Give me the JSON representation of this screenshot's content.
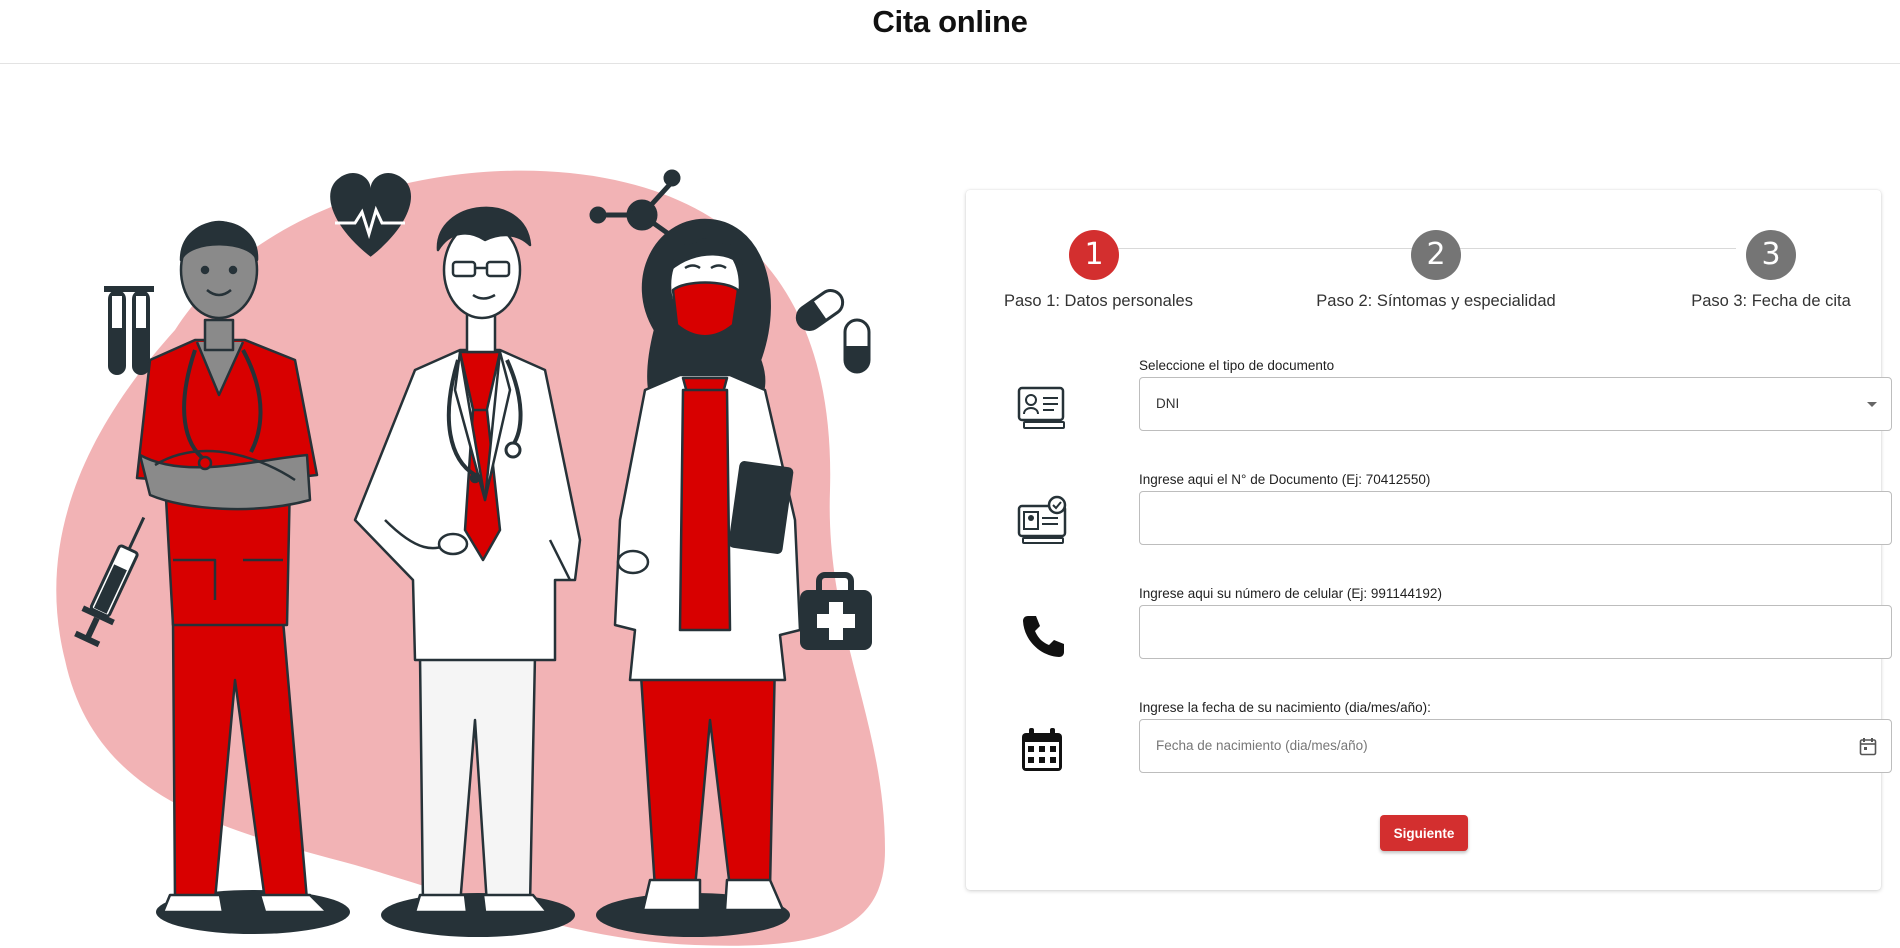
{
  "header": {
    "title": "Cita online"
  },
  "stepper": {
    "steps": [
      {
        "number": "1",
        "label": "Paso 1: Datos personales",
        "state": "active"
      },
      {
        "number": "2",
        "label": "Paso 2: Síntomas y especialidad",
        "state": "inactive"
      },
      {
        "number": "3",
        "label": "Paso 3: Fecha de cita",
        "state": "inactive"
      }
    ]
  },
  "form": {
    "document_type": {
      "label": "Seleccione el tipo de documento",
      "value": "DNI",
      "icon": "id-card-icon"
    },
    "document_number": {
      "label": "Ingrese aqui el N° de Documento (Ej: 70412550)",
      "value": "",
      "icon": "verified-id-icon"
    },
    "phone": {
      "label": "Ingrese aqui su número de celular (Ej: 991144192)",
      "value": "",
      "icon": "phone-icon"
    },
    "birth_date": {
      "label": "Ingrese la fecha de su nacimiento (dia/mes/año):",
      "placeholder": "Fecha de nacimiento (dia/mes/año)",
      "icon": "calendar-icon"
    },
    "next_label": "Siguiente"
  },
  "colors": {
    "accent": "#d32f2f",
    "inactive_step": "#757575",
    "illustration_blob": "#f2b3b5",
    "scrub_red": "#d80000",
    "ink": "#263238"
  }
}
